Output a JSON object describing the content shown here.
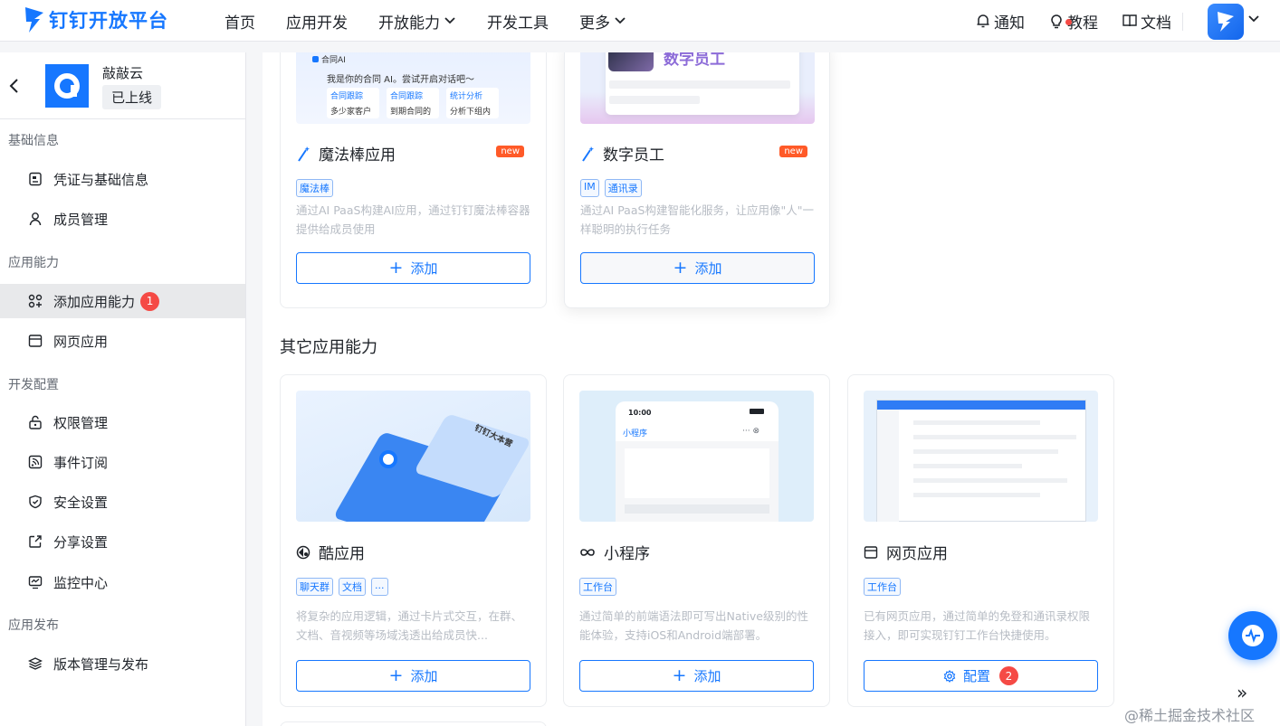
{
  "brand": {
    "name": "钉钉开放平台",
    "color": "#1677ff"
  },
  "nav": {
    "items": [
      "首页",
      "应用开发",
      "开放能力",
      "开发工具",
      "更多"
    ],
    "right": {
      "notify": "通知",
      "tutorial": "教程",
      "docs": "文档"
    }
  },
  "app": {
    "name": "敲敲云",
    "status": "已上线"
  },
  "sidebar": {
    "sections": [
      {
        "title": "基础信息",
        "items": [
          {
            "label": "凭证与基础信息",
            "icon": "credential-icon"
          },
          {
            "label": "成员管理",
            "icon": "user-icon"
          }
        ]
      },
      {
        "title": "应用能力",
        "items": [
          {
            "label": "添加应用能力",
            "icon": "apps-add-icon",
            "badge": "1",
            "active": true
          },
          {
            "label": "网页应用",
            "icon": "browser-icon"
          }
        ]
      },
      {
        "title": "开发配置",
        "items": [
          {
            "label": "权限管理",
            "icon": "lock-icon"
          },
          {
            "label": "事件订阅",
            "icon": "rss-icon"
          },
          {
            "label": "安全设置",
            "icon": "shield-icon"
          },
          {
            "label": "分享设置",
            "icon": "share-icon"
          },
          {
            "label": "监控中心",
            "icon": "monitor-icon"
          }
        ]
      },
      {
        "title": "应用发布",
        "items": [
          {
            "label": "版本管理与发布",
            "icon": "layers-icon"
          }
        ]
      }
    ]
  },
  "cards_top": [
    {
      "title": "魔法棒应用",
      "tag_new": "new",
      "tags": [
        "魔法棒"
      ],
      "desc": "通过AI PaaS构建AI应用，通过钉钉魔法棒容器提供给成员使用",
      "button": "添加",
      "thumb": {
        "header": "合同AI",
        "greeting": "我是你的合同 AI。尝试开启对话吧～",
        "chips": [
          "合同跟踪",
          "合同跟踪",
          "统计分析"
        ],
        "captions": [
          "多少家客户",
          "到期合同的",
          "分析下组内"
        ]
      }
    },
    {
      "title": "数字员工",
      "tag_new": "new",
      "tags": [
        "IM",
        "通讯录"
      ],
      "desc": "通过AI PaaS构建智能化服务，让应用像\"人\"一样聪明的执行任务",
      "button": "添加",
      "thumb": {
        "label": "数字员工"
      }
    }
  ],
  "other_heading": "其它应用能力",
  "cards_other": [
    {
      "title": "酷应用",
      "icon": "cool-app-icon",
      "tags": [
        "聊天群",
        "文档",
        "..."
      ],
      "desc": "将复杂的应用逻辑，通过卡片式交互，在群、文档、音视频等场域浅透出给成员快...",
      "button": "添加",
      "thumb": {
        "label": "钉钉大本营"
      }
    },
    {
      "title": "小程序",
      "icon": "infinity-icon",
      "tags": [
        "工作台"
      ],
      "desc": "通过简单的前端语法即可写出Native级别的性能体验，支持iOS和Android端部署。",
      "button": "添加",
      "thumb": {
        "time": "10:00",
        "label": "小程序"
      }
    },
    {
      "title": "网页应用",
      "icon": "browser-icon",
      "tags": [
        "工作台"
      ],
      "desc": "已有网页应用，通过简单的免登和通讯录权限接入，即可实现钉钉工作台快捷使用。",
      "button": "配置",
      "button_badge": "2"
    }
  ],
  "watermark": "@稀土掘金技术社区"
}
